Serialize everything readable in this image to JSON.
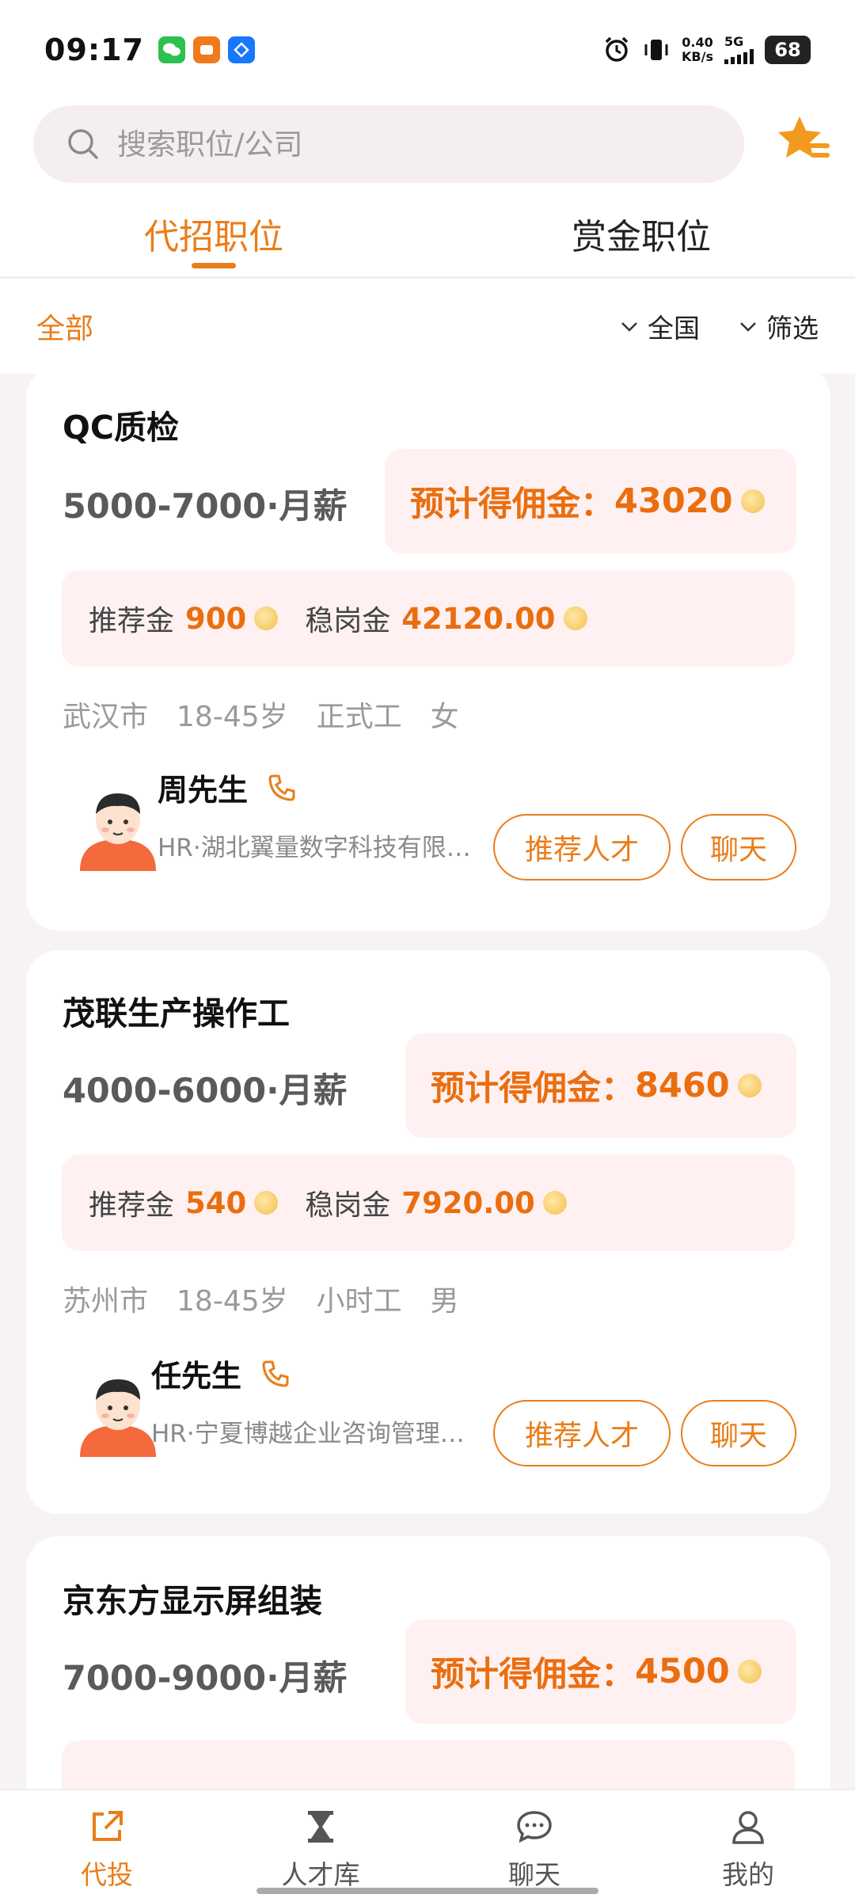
{
  "status_bar": {
    "time": "09:17",
    "net_speed_value": "0.40",
    "net_speed_unit": "KB/s",
    "network": "5G",
    "battery": "68",
    "app_icons": [
      "wechat-icon",
      "app-icon-orange",
      "app-icon-blue"
    ]
  },
  "search": {
    "placeholder": "搜索职位/公司"
  },
  "tabs": [
    {
      "label": "代招职位",
      "active": true
    },
    {
      "label": "赏金职位",
      "active": false
    }
  ],
  "filters": {
    "all_label": "全部",
    "region_label": "全国",
    "filter_label": "筛选"
  },
  "labels": {
    "commission_prefix": "预计得佣金：",
    "referral_label": "推荐金",
    "retention_label": "稳岗金",
    "recommend_button": "推荐人才",
    "chat_button": "聊天"
  },
  "jobs": [
    {
      "title": "QC质检",
      "salary": "5000-7000·月薪",
      "commission": "43020",
      "referral": "900",
      "retention": "42120.00",
      "tags": [
        "武汉市",
        "18-45岁",
        "正式工",
        "女"
      ],
      "hr_name": "周先生",
      "hr_company": "HR·湖北翼量数字科技有限公司"
    },
    {
      "title": "茂联生产操作工",
      "salary": "4000-6000·月薪",
      "commission": "8460",
      "referral": "540",
      "retention": "7920.00",
      "tags": [
        "苏州市",
        "18-45岁",
        "小时工",
        "男"
      ],
      "hr_name": "任先生",
      "hr_company": "HR·宁夏博越企业咨询管理有限公司"
    },
    {
      "title": "京东方显示屏组装",
      "salary": "7000-9000·月薪",
      "commission": "4500"
    }
  ],
  "bottom_nav": [
    {
      "label": "代投",
      "icon": "share-icon",
      "active": true
    },
    {
      "label": "人才库",
      "icon": "hourglass-icon",
      "active": false
    },
    {
      "label": "聊天",
      "icon": "chat-bubble-icon",
      "active": false
    },
    {
      "label": "我的",
      "icon": "user-icon",
      "active": false
    }
  ],
  "colors": {
    "accent": "#ea7d19",
    "commission_bg": "#fff1f1",
    "page_bg": "#f7f2f5"
  }
}
